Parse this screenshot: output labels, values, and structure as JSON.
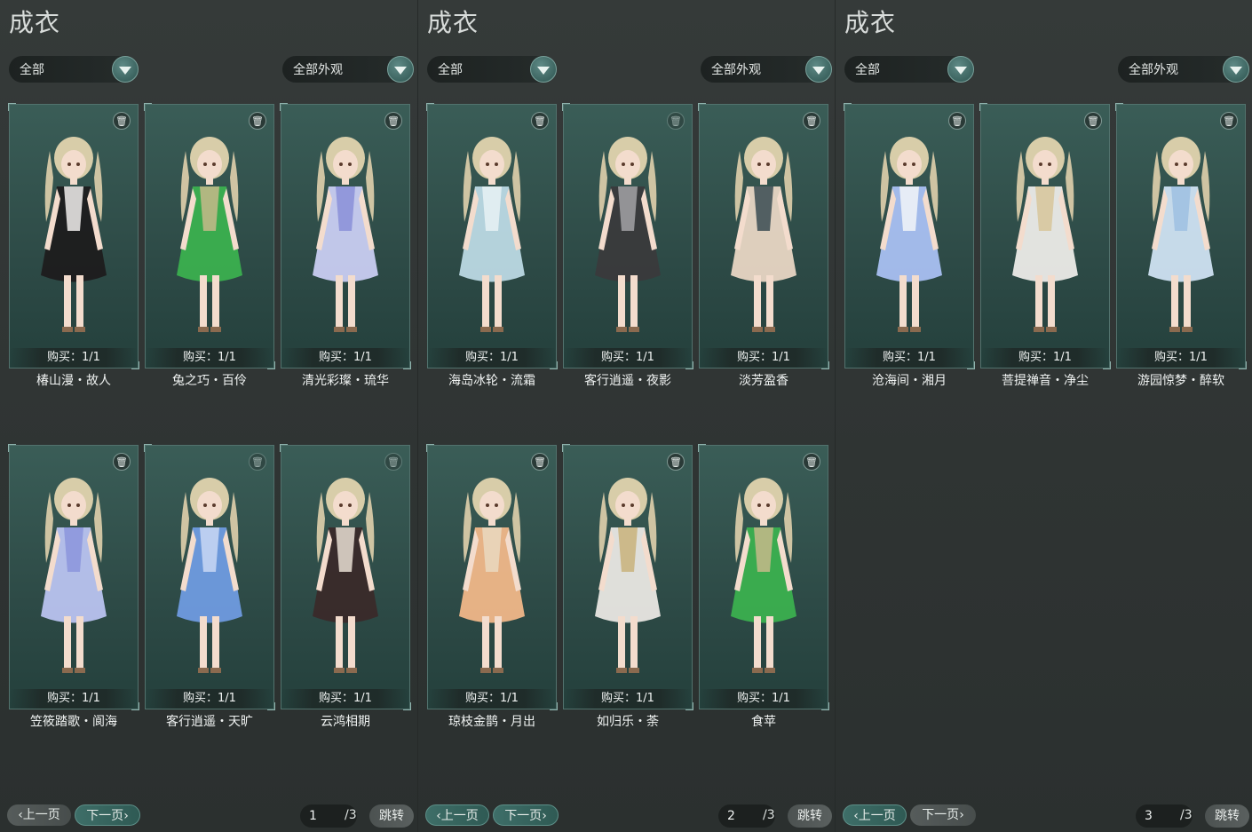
{
  "panels": [
    {
      "title": "成衣",
      "filter_left": "全部",
      "filter_right": "全部外观",
      "cards": [
        {
          "name": "椿山漫・故人",
          "buy": "购买：1/1",
          "dress": "#1e1c1e",
          "accent": "#f2f0ee",
          "trash_enabled": true
        },
        {
          "name": "兔之巧・百伶",
          "buy": "购买：1/1",
          "dress": "#3bb04f",
          "accent": "#c7b88a",
          "trash_enabled": true
        },
        {
          "name": "清光彩璨・琉华",
          "buy": "购买：1/1",
          "dress": "#c9cdf2",
          "accent": "#8a8fd8",
          "trash_enabled": true
        },
        {
          "name": "笠筱踏歌・阆海",
          "buy": "购买：1/1",
          "dress": "#b9c3f0",
          "accent": "#8b95dc",
          "trash_enabled": true
        },
        {
          "name": "客行逍遥・天旷",
          "buy": "购买：1/1",
          "dress": "#6f9be0",
          "accent": "#c9d7f3",
          "trash_enabled": false
        },
        {
          "name": "云鸿相期",
          "buy": "购买：1/1",
          "dress": "#3a2a2a",
          "accent": "#e9dfd4",
          "trash_enabled": false
        }
      ],
      "prev_label": "上一页",
      "next_label": "下一页",
      "page": "1",
      "total": "/3",
      "jump_label": "跳转"
    },
    {
      "title": "成衣",
      "filter_left": "全部",
      "filter_right": "全部外观",
      "cards": [
        {
          "name": "海岛冰轮・流霜",
          "buy": "购买：1/1",
          "dress": "#bcd9e4",
          "accent": "#e7f2f5",
          "trash_enabled": true
        },
        {
          "name": "客行逍遥・夜影",
          "buy": "购买：1/1",
          "dress": "#3a3a3c",
          "accent": "#a3a3a6",
          "trash_enabled": false
        },
        {
          "name": "淡芳盈香",
          "buy": "购买：1/1",
          "dress": "#e8d6c4",
          "accent": "#3a4b52",
          "trash_enabled": true
        },
        {
          "name": "琼枝金鹊・月出",
          "buy": "购买：1/1",
          "dress": "#f0b789",
          "accent": "#e9d8c0",
          "trash_enabled": true
        },
        {
          "name": "如归乐・荼",
          "buy": "购买：1/1",
          "dress": "#e9e7e3",
          "accent": "#c9b37b",
          "trash_enabled": true
        },
        {
          "name": "食苹",
          "buy": "购买：1/1",
          "dress": "#3bb04f",
          "accent": "#c7b88a",
          "trash_enabled": true
        }
      ],
      "prev_label": "上一页",
      "next_label": "下一页",
      "page": "2",
      "total": "/3",
      "jump_label": "跳转"
    },
    {
      "title": "成衣",
      "filter_left": "全部",
      "filter_right": "全部外观",
      "cards": [
        {
          "name": "沧海间・湘月",
          "buy": "购买：1/1",
          "dress": "#a9c0f2",
          "accent": "#f2f4f8",
          "trash_enabled": true
        },
        {
          "name": "菩提禅音・净尘",
          "buy": "购买：1/1",
          "dress": "#ecebe8",
          "accent": "#d7c59a",
          "trash_enabled": true
        },
        {
          "name": "游园惊梦・醉软",
          "buy": "购买：1/1",
          "dress": "#cfe2f2",
          "accent": "#9ec0e2",
          "trash_enabled": true
        }
      ],
      "prev_label": "上一页",
      "next_label": "下一页",
      "page": "3",
      "total": "/3",
      "jump_label": "跳转"
    }
  ]
}
